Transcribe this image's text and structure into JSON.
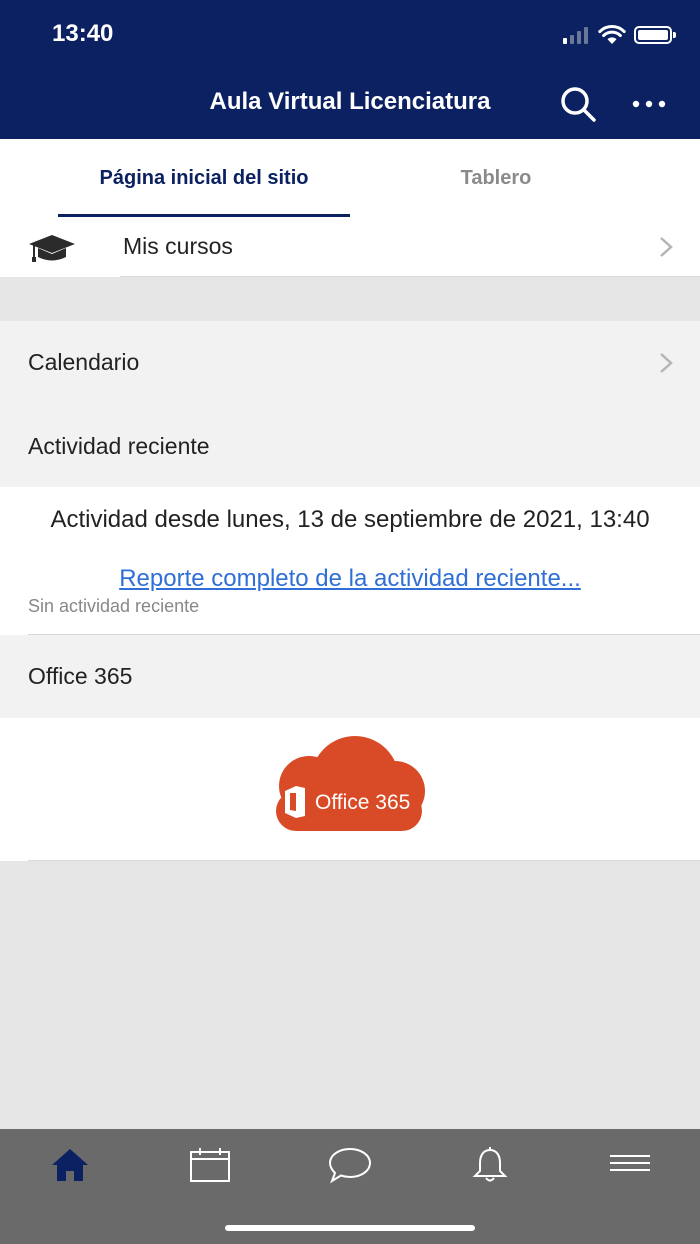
{
  "status_bar": {
    "time": "13:40"
  },
  "header": {
    "title": "Aula Virtual Licenciatura",
    "search_icon": "search-icon",
    "more_icon": "more-icon"
  },
  "tabs": [
    {
      "label": "Página inicial del sitio",
      "active": true
    },
    {
      "label": "Tablero",
      "active": false
    }
  ],
  "courses": {
    "label": "Mis cursos",
    "icon": "graduation-cap-icon"
  },
  "calendar": {
    "label": "Calendario"
  },
  "recent_activity": {
    "title": "Actividad reciente",
    "since": "Actividad desde lunes, 13 de septiembre de 2021, 13:40",
    "report_link": "Reporte completo de la actividad reciente...",
    "empty": "Sin actividad reciente"
  },
  "office": {
    "title": "Office 365",
    "logo_text": "Office 365",
    "logo_color": "#d94b26"
  },
  "bottom_nav": [
    {
      "name": "home",
      "icon": "home-icon",
      "active": true
    },
    {
      "name": "calendar",
      "icon": "calendar-icon",
      "active": false
    },
    {
      "name": "messages",
      "icon": "chat-icon",
      "active": false
    },
    {
      "name": "notifications",
      "icon": "bell-icon",
      "active": false
    },
    {
      "name": "menu",
      "icon": "menu-icon",
      "active": false
    }
  ],
  "colors": {
    "header_bg": "#0c2161",
    "link": "#2f6fd6",
    "tabbar_bg": "#6a6a6a"
  }
}
